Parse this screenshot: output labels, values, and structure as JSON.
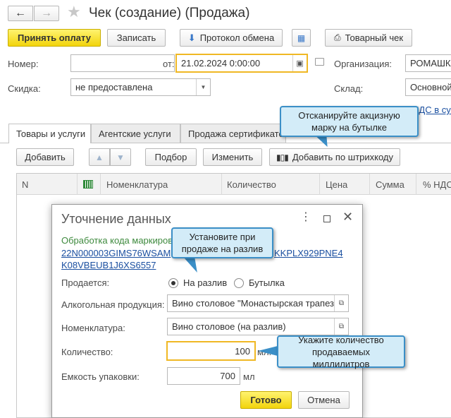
{
  "header": {
    "back_icon": "arrow-left-icon",
    "forward_icon": "arrow-right-icon",
    "star_icon": "star-icon",
    "title": "Чек (создание) (Продажа)"
  },
  "toolbar": {
    "accept_payment": "Принять оплату",
    "save": "Записать",
    "exchange_log": "Протокол обмена",
    "goods_receipt": "Товарный чек"
  },
  "form": {
    "number_label": "Номер:",
    "number_value": "",
    "date_label": "от:",
    "date_value": "21.02.2024  0:00:00",
    "org_label": "Организация:",
    "org_value": "РОМАШКА",
    "discount_label": "Скидка:",
    "discount_value": "не предоставлена",
    "warehouse_label": "Склад:",
    "warehouse_value": "Основной",
    "vat_link": "НДС в сум"
  },
  "tabs": [
    {
      "label": "Товары и услуги"
    },
    {
      "label": "Агентские услуги"
    },
    {
      "label": "Продажа сертификато"
    }
  ],
  "table_toolbar": {
    "add": "Добавить",
    "pick": "Подбор",
    "edit": "Изменить",
    "add_by_barcode": "Добавить по штрихкоду"
  },
  "table": {
    "columns": [
      "N",
      "",
      "Номенклатура",
      "Количество",
      "Цена",
      "Сумма",
      "% НДС"
    ]
  },
  "dialog": {
    "title": "Уточнение данных",
    "section_text": "Обработка кода маркиров",
    "code_line1": "22N000003GIMS76WSAM",
    "code_line1_end": "KKPLX929PNE4",
    "code_line2": "K08VBEUB1J6XS6557",
    "sold_label": "Продается:",
    "radio_bulk": "На разлив",
    "radio_bottle": "Бутылка",
    "alcohol_label": "Алкогольная продукция:",
    "alcohol_value": "Вино столовое \"Монастырская трапез",
    "nomenclature_label": "Номенклатура:",
    "nomenclature_value": "Вино столовое (на разлив)",
    "quantity_label": "Количество:",
    "quantity_value": "100",
    "quantity_unit": "мл.",
    "capacity_label": "Емкость упаковки:",
    "capacity_value": "700",
    "capacity_unit": "мл",
    "ok": "Готово",
    "cancel": "Отмена"
  },
  "tooltips": {
    "scan": "Отсканируйте акцизную марку на бутылке",
    "bulk": "Установите при продаже на разлив",
    "quantity": "Укажите количество продаваемых миллилитров"
  },
  "colors": {
    "accent_yellow": "#f2d40c",
    "focus_border": "#f0b824",
    "tooltip_bg": "#d3ecf8",
    "tooltip_border": "#3b8fc7",
    "link": "#1a4fa0"
  }
}
